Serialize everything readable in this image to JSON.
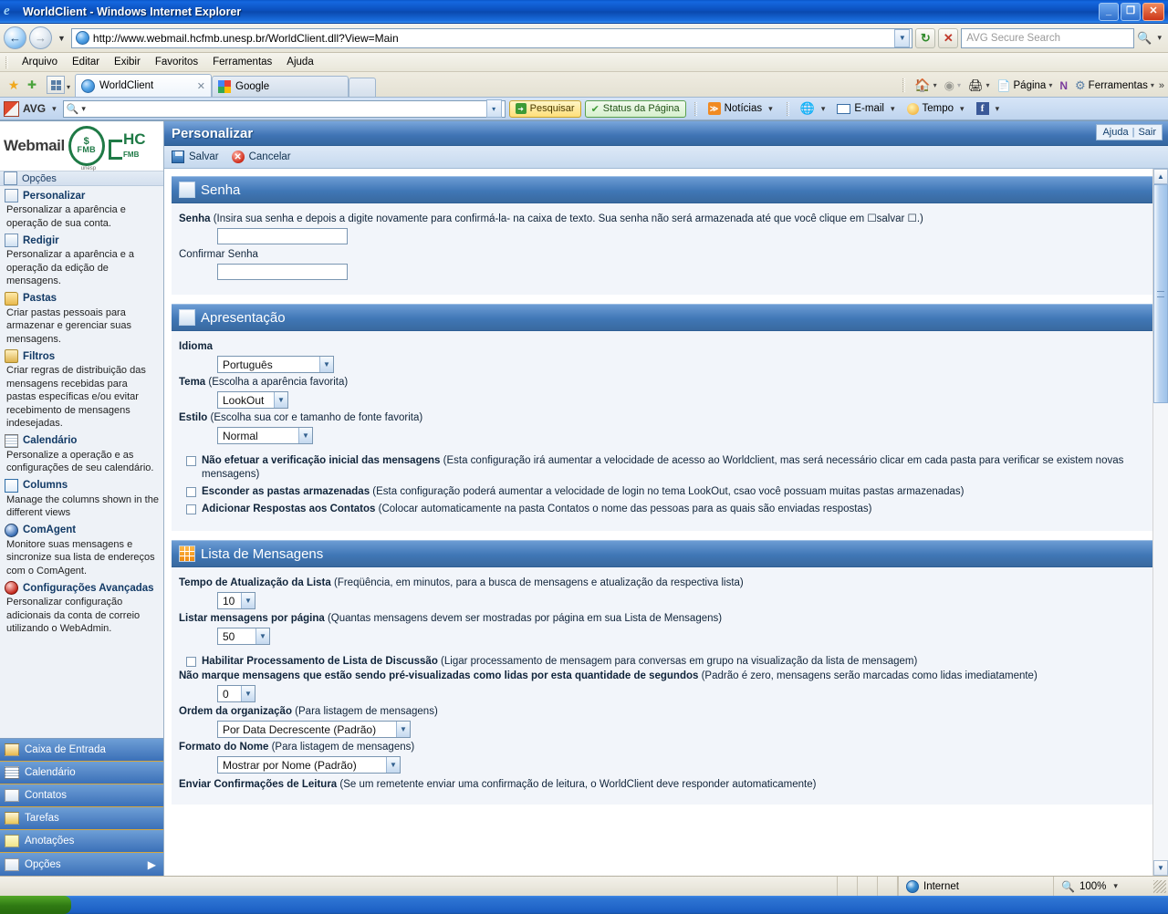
{
  "window": {
    "title": "WorldClient - Windows Internet Explorer",
    "minimize": "_",
    "maximize": "❐",
    "close": "✕"
  },
  "address_bar": {
    "back": "←",
    "forward": "→",
    "history_caret": "▼",
    "url": "http://www.webmail.hcfmb.unesp.br/WorldClient.dll?View=Main",
    "url_caret": "▼",
    "refresh": "↻",
    "stop": "✕",
    "avg_search_placeholder": "AVG Secure Search",
    "search_icon": "🔍",
    "search_caret": "▾"
  },
  "menu": [
    "Arquivo",
    "Editar",
    "Exibir",
    "Favoritos",
    "Ferramentas",
    "Ajuda"
  ],
  "tabs": {
    "favorites_icon": "★",
    "add_favorite_icon": "✚",
    "quick_tabs_caret": "▾",
    "items": [
      {
        "label": "WorldClient",
        "active": true,
        "close": "✕"
      },
      {
        "label": "Google",
        "active": false,
        "close": ""
      }
    ],
    "commands": [
      {
        "label": "",
        "icon": "home-icon",
        "caret": "▾"
      },
      {
        "label": "",
        "icon": "feeds-icon",
        "caret": "▾"
      },
      {
        "label": "",
        "icon": "print-icon",
        "caret": "▾"
      },
      {
        "label": "Página",
        "icon": "page-icon",
        "caret": "▾"
      },
      {
        "label": "",
        "icon": "onenote-icon",
        "caret": ""
      },
      {
        "label": "Ferramentas",
        "icon": "gear-icon",
        "caret": "▾"
      }
    ],
    "overflow": "»"
  },
  "avg_toolbar": {
    "brand": "AVG",
    "brand_caret": "▾",
    "search_value": "",
    "search_caret": "▾",
    "search_button": "Pesquisar",
    "page_status_button": "Status da Página",
    "items": [
      {
        "label": "Notícias",
        "icon": "rss-icon",
        "caret": "▾"
      },
      {
        "label": "",
        "icon": "browser-icon",
        "caret": "▾"
      },
      {
        "label": "E-mail",
        "icon": "mail-icon",
        "caret": "▾"
      },
      {
        "label": "Tempo",
        "icon": "weather-icon",
        "caret": "▾"
      },
      {
        "label": "",
        "icon": "facebook-icon",
        "caret": "▾"
      }
    ]
  },
  "sidebar": {
    "brand": {
      "webmail": "Webmail",
      "seal_dollar": "$",
      "seal_text": "FMB",
      "seal_sub": "unesp",
      "hc": "HC",
      "hc_sub": "FMB"
    },
    "options_header": {
      "label": "Opções",
      "icon": "options-icon"
    },
    "groups": [
      {
        "title": "Personalizar",
        "icon": "personalize-icon",
        "desc": "Personalizar a aparência e operação de sua conta."
      },
      {
        "title": "Redigir",
        "icon": "compose-icon",
        "desc": "Personalizar a aparência e a operação da edição de mensagens."
      },
      {
        "title": "Pastas",
        "icon": "folders-icon",
        "desc": "Criar pastas pessoais para armazenar e gerenciar suas mensagens."
      },
      {
        "title": "Filtros",
        "icon": "filters-icon",
        "desc": "Criar regras de distribuição das mensagens recebidas para pastas específicas e/ou evitar recebimento de mensagens indesejadas."
      },
      {
        "title": "Calendário",
        "icon": "calendar-icon",
        "desc": "Personalize a operação e as configurações de seu calendário."
      },
      {
        "title": "Columns",
        "icon": "columns-icon",
        "desc": "Manage the columns shown in the different views"
      },
      {
        "title": "ComAgent",
        "icon": "comagent-icon",
        "desc": "Monitore suas mensagens e sincronize sua lista de endereços com o ComAgent."
      },
      {
        "title": "Configurações Avançadas",
        "icon": "advanced-icon",
        "desc": "Personalizar configuração adicionais da conta de correio utilizando o WebAdmin."
      }
    ],
    "nav": [
      {
        "label": "Caixa de Entrada",
        "icon": "inbox-icon",
        "selected": false
      },
      {
        "label": "Calendário",
        "icon": "calendar-icon",
        "selected": false
      },
      {
        "label": "Contatos",
        "icon": "contacts-icon",
        "selected": false
      },
      {
        "label": "Tarefas",
        "icon": "tasks-icon",
        "selected": false
      },
      {
        "label": "Anotações",
        "icon": "notes-icon",
        "selected": false
      },
      {
        "label": "Opções",
        "icon": "options-icon",
        "selected": true,
        "arrow": "▶"
      }
    ]
  },
  "main": {
    "title": "Personalizar",
    "help_label": "Ajuda",
    "help_sep": "|",
    "logout_label": "Sair",
    "toolbar": {
      "save_label": "Salvar",
      "cancel_label": "Cancelar",
      "cancel_glyph": "✕"
    },
    "sections": {
      "password": {
        "heading": "Senha",
        "icon": "password-card-icon",
        "label_bold": "Senha",
        "label_rest": " (Insira sua senha e depois a digite novamente para confirmá-la- na caixa de texto. Sua senha não será armazenada até que você clique em ☐salvar ☐.)",
        "password_value": "",
        "confirm_label": "Confirmar Senha",
        "confirm_value": ""
      },
      "presentation": {
        "heading": "Apresentação",
        "icon": "presentation-icon",
        "language_label": "Idioma",
        "language_value": "Português",
        "theme_label_bold": "Tema",
        "theme_label_rest": " (Escolha a aparência favorita)",
        "theme_value": "LookOut",
        "style_label_bold": "Estilo",
        "style_label_rest": " (Escolha sua cor e tamanho de fonte favorita)",
        "style_value": "Normal",
        "checkboxes": [
          {
            "bold": "Não efetuar a verificação inicial das mensagens",
            "rest": " (Esta configuração irá aumentar a velocidade de acesso ao Worldclient, mas será necessário clicar em cada pasta para verificar se existem novas mensagens)",
            "checked": false
          },
          {
            "bold": "Esconder as pastas armazenadas",
            "rest": " (Esta configuração poderá aumentar a velocidade de login no tema LookOut, csao você possuam muitas pastas armazenadas)",
            "checked": false
          },
          {
            "bold": "Adicionar Respostas aos Contatos",
            "rest": " (Colocar automaticamente na pasta Contatos o nome das pessoas para as quais são enviadas respostas)",
            "checked": false
          }
        ]
      },
      "message_list": {
        "heading": "Lista de Mensagens",
        "icon": "message-list-icon",
        "refresh_label_bold": "Tempo de Atualização da Lista",
        "refresh_label_rest": " (Freqüência, em minutos, para a busca de mensagens e atualização da respectiva lista)",
        "refresh_value": "10",
        "perpage_label_bold": "Listar mensagens por página",
        "perpage_label_rest": " (Quantas mensagens devem ser mostradas por página em sua Lista de Mensagens)",
        "perpage_value": "50",
        "mailing_list_bold": "Habilitar Processamento de Lista de Discussão",
        "mailing_list_rest": " (Ligar processamento de mensagem para conversas em grupo na visualização da lista de mensagem)",
        "mailing_list_checked": false,
        "preview_label_bold": "Não marque mensagens que estão sendo pré-visualizadas como lidas por esta quantidade de segundos",
        "preview_label_rest": " (Padrão é zero, mensagens serão marcadas como lidas imediatamente)",
        "preview_value": "0",
        "sort_label_bold": "Ordem da organização",
        "sort_label_rest": " (Para listagem de mensagens)",
        "sort_value": "Por Data Decrescente (Padrão)",
        "name_format_label_bold": "Formato do Nome",
        "name_format_label_rest": " (Para listagem de mensagens)",
        "name_format_value": "Mostrar por Nome (Padrão)",
        "read_receipt_bold": "Enviar Confirmações de Leitura",
        "read_receipt_rest": " (Se um remetente enviar uma confirmação de leitura, o WorldClient deve responder automaticamente)"
      }
    },
    "scrollbar": {
      "up": "▲",
      "down": "▼"
    }
  },
  "status_bar": {
    "message": "",
    "zone": "Internet",
    "zone_icon": "globe-icon",
    "zoom": "100%",
    "zoom_caret": "▾"
  }
}
